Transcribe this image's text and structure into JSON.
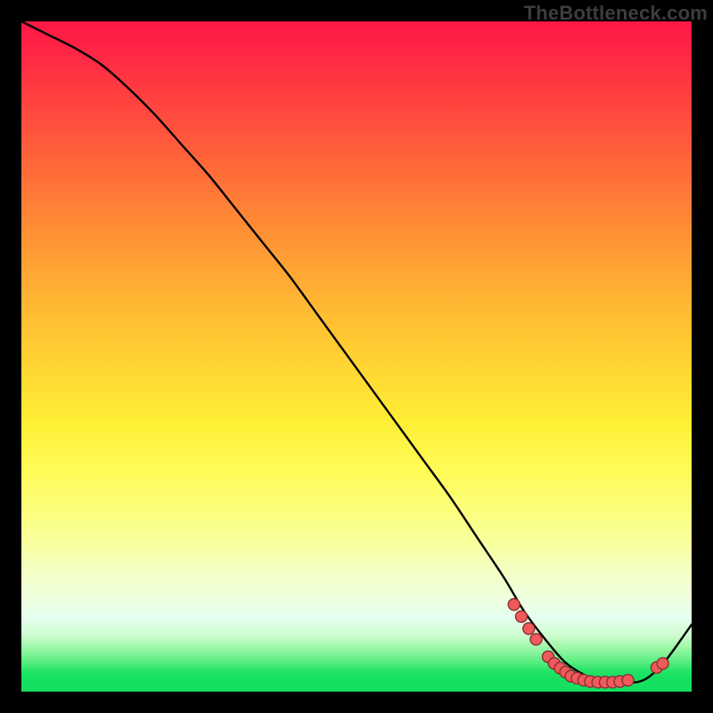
{
  "watermark": "TheBottleneck.com",
  "colors": {
    "curve": "#000000",
    "marker_fill": "#f05a5a",
    "marker_stroke": "#8a2f34"
  },
  "chart_data": {
    "type": "line",
    "title": "",
    "xlabel": "",
    "ylabel": "",
    "xlim": [
      0,
      100
    ],
    "ylim": [
      0,
      100
    ],
    "grid": false,
    "series": [
      {
        "name": "bottleneck-curve",
        "x": [
          0,
          4,
          8,
          12,
          16,
          20,
          24,
          28,
          32,
          36,
          40,
          44,
          48,
          52,
          56,
          60,
          64,
          68,
          72,
          75,
          78,
          81,
          84,
          87,
          90,
          93,
          96,
          100
        ],
        "y": [
          100,
          98,
          96,
          93.5,
          90,
          86,
          81.5,
          77,
          72,
          67,
          62,
          56.5,
          51,
          45.5,
          40,
          34.5,
          29,
          23,
          17,
          12,
          8,
          4.5,
          2.5,
          1.5,
          1.3,
          1.8,
          4.5,
          10
        ]
      }
    ],
    "markers": {
      "name": "highlight-dots",
      "points": [
        {
          "x": 73.5,
          "y": 13.0
        },
        {
          "x": 74.6,
          "y": 11.2
        },
        {
          "x": 75.7,
          "y": 9.4
        },
        {
          "x": 76.8,
          "y": 7.8
        },
        {
          "x": 78.6,
          "y": 5.2
        },
        {
          "x": 79.5,
          "y": 4.2
        },
        {
          "x": 80.4,
          "y": 3.5
        },
        {
          "x": 81.2,
          "y": 2.9
        },
        {
          "x": 82.0,
          "y": 2.3
        },
        {
          "x": 82.9,
          "y": 2.0
        },
        {
          "x": 83.9,
          "y": 1.7
        },
        {
          "x": 84.9,
          "y": 1.5
        },
        {
          "x": 86.0,
          "y": 1.4
        },
        {
          "x": 87.1,
          "y": 1.4
        },
        {
          "x": 88.2,
          "y": 1.4
        },
        {
          "x": 89.3,
          "y": 1.5
        },
        {
          "x": 90.5,
          "y": 1.7
        },
        {
          "x": 94.8,
          "y": 3.6
        },
        {
          "x": 95.7,
          "y": 4.2
        }
      ]
    }
  }
}
